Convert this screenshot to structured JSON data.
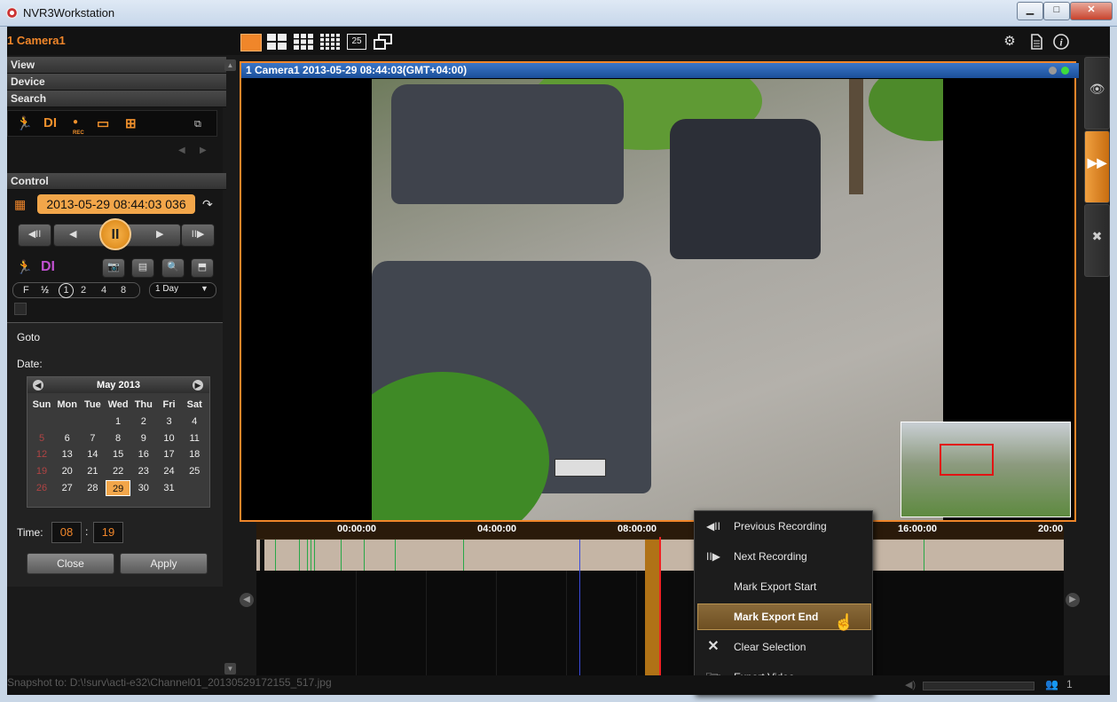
{
  "window": {
    "title": "NVR3Workstation",
    "minimize": "▁",
    "maximize": "□",
    "close": "✕"
  },
  "topbar": {
    "camera_name": "1 Camera1",
    "layout_25": "25"
  },
  "left": {
    "sections": {
      "view": "View",
      "device": "Device",
      "search": "Search",
      "control": "Control"
    },
    "event_icons": [
      "motion-icon",
      "di-icon",
      "rec-icon",
      "video-loss-icon",
      "network-icon"
    ],
    "di_label": "DI",
    "current_time": "2013-05-29 08:44:03 036",
    "speeds": [
      "F",
      "½",
      "1",
      "2",
      "4",
      "8"
    ],
    "range": "1 Day",
    "goto": {
      "title": "Goto",
      "date_label": "Date:",
      "month": "May 2013",
      "weekdays": [
        "Sun",
        "Mon",
        "Tue",
        "Wed",
        "Thu",
        "Fri",
        "Sat"
      ],
      "days": [
        [
          "",
          "",
          "",
          "1",
          "2",
          "3",
          "4"
        ],
        [
          "5",
          "6",
          "7",
          "8",
          "9",
          "10",
          "11"
        ],
        [
          "12",
          "13",
          "14",
          "15",
          "16",
          "17",
          "18"
        ],
        [
          "19",
          "20",
          "21",
          "22",
          "23",
          "24",
          "25"
        ],
        [
          "26",
          "27",
          "28",
          "29",
          "30",
          "31",
          ""
        ]
      ],
      "selected_day": "29",
      "time_label": "Time:",
      "hour": "08",
      "minute": "19",
      "colon": ":",
      "close_label": "Close",
      "apply_label": "Apply"
    }
  },
  "video": {
    "header": "1 Camera1   2013-05-29 08:44:03(GMT+04:00)"
  },
  "timeline": {
    "ticks": [
      "00:00:00",
      "04:00:00",
      "08:00:00",
      "16:00:00",
      "20:00"
    ]
  },
  "context_menu": {
    "items": [
      {
        "label": "Previous Recording",
        "icon": "previous-recording-icon"
      },
      {
        "label": "Next Recording",
        "icon": "next-recording-icon"
      },
      {
        "label": "Mark Export Start",
        "icon": ""
      },
      {
        "label": "Mark Export End",
        "icon": ""
      },
      {
        "label": "Clear Selection",
        "icon": "clear-icon"
      },
      {
        "label": "Export Video",
        "icon": "export-icon"
      }
    ],
    "highlighted": "Mark Export End"
  },
  "status": {
    "snapshot": "Snapshot to: D:\\!surv\\acti-e32\\Channel01_20130529172155_517.jpg",
    "users": "1"
  },
  "colors": {
    "accent": "#f0862a",
    "video_header": "#2a62b4",
    "selection": "#b07216",
    "playhead": "#e22222"
  }
}
